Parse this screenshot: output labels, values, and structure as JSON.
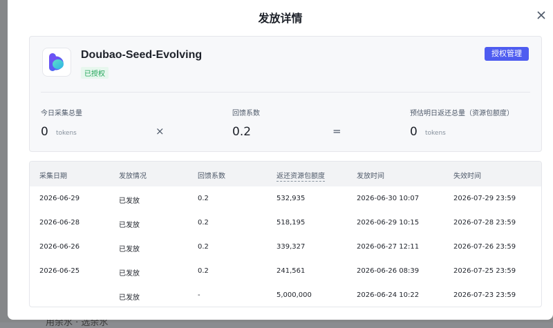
{
  "modal": {
    "title": "发放详情"
  },
  "model": {
    "name": "Doubao-Seed-Evolving",
    "status_tag": "已授权",
    "manage_button": "授权管理"
  },
  "metrics": {
    "collected": {
      "label": "今日采集总量",
      "value": "0",
      "unit": "tokens"
    },
    "op_multiply": "×",
    "coefficient": {
      "label": "回馈系数",
      "value": "0.2"
    },
    "op_equals": "=",
    "estimate": {
      "label": "预估明日返还总量（资源包额度）",
      "value": "0",
      "unit": "tokens"
    }
  },
  "table": {
    "columns": [
      "采集日期",
      "发放情况",
      "回馈系数",
      "返还资源包额度",
      "发放时间",
      "失效时间"
    ],
    "rows": [
      [
        "2026-06-29",
        "已发放",
        "0.2",
        "532,935",
        "2026-06-30 10:07",
        "2026-07-29 23:59"
      ],
      [
        "2026-06-28",
        "已发放",
        "0.2",
        "518,195",
        "2026-06-29 10:15",
        "2026-07-28 23:59"
      ],
      [
        "2026-06-26",
        "已发放",
        "0.2",
        "339,327",
        "2026-06-27 12:11",
        "2026-07-26 23:59"
      ],
      [
        "2026-06-25",
        "已发放",
        "0.2",
        "241,561",
        "2026-06-26 08:39",
        "2026-07-25 23:59"
      ],
      [
        "",
        "已发放",
        "-",
        "5,000,000",
        "2026-06-24 10:22",
        "2026-07-23 23:59"
      ]
    ]
  },
  "background": {
    "partial_text": "用余水 · 选余水"
  },
  "colors": {
    "primary": "#4e5cf0",
    "success": "#23a55a"
  }
}
